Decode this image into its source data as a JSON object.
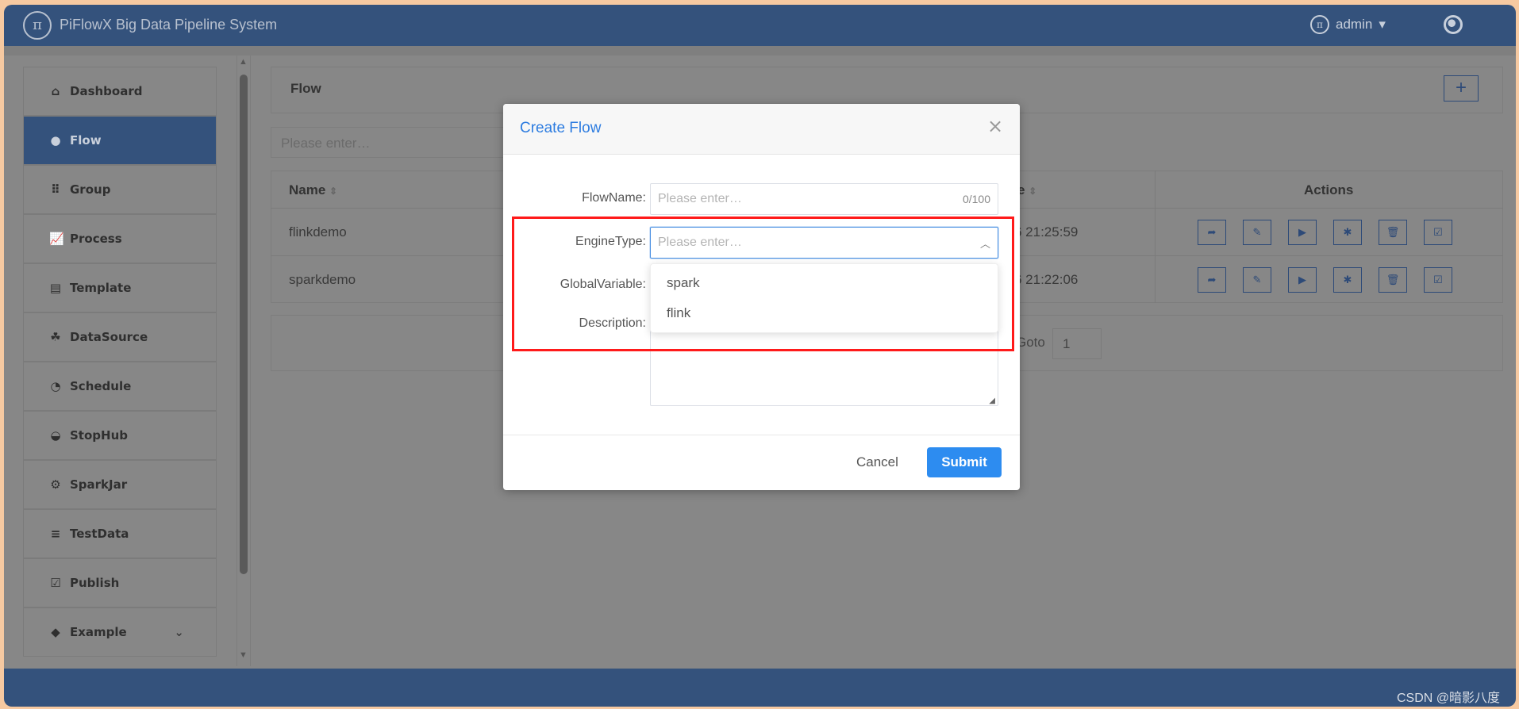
{
  "header": {
    "title": "PiFlowX Big Data Pipeline System",
    "logo_text": "π",
    "user": "admin"
  },
  "sidebar": {
    "items": [
      {
        "label": "Dashboard",
        "icon": "home-icon",
        "glyph": "⌂"
      },
      {
        "label": "Flow",
        "icon": "flow-icon",
        "glyph": "●",
        "active": true
      },
      {
        "label": "Group",
        "icon": "grid-icon",
        "glyph": "⠿"
      },
      {
        "label": "Process",
        "icon": "chart-icon",
        "glyph": "📈"
      },
      {
        "label": "Template",
        "icon": "document-icon",
        "glyph": "▤"
      },
      {
        "label": "DataSource",
        "icon": "datasource-icon",
        "glyph": "☘"
      },
      {
        "label": "Schedule",
        "icon": "clock-icon",
        "glyph": "◔"
      },
      {
        "label": "StopHub",
        "icon": "gauge-icon",
        "glyph": "◒"
      },
      {
        "label": "SparkJar",
        "icon": "gear-icon",
        "glyph": "⚙"
      },
      {
        "label": "TestData",
        "icon": "lines-icon",
        "glyph": "≡"
      },
      {
        "label": "Publish",
        "icon": "check-square-icon",
        "glyph": "☑"
      },
      {
        "label": "Example",
        "icon": "cube-icon",
        "glyph": "◆",
        "chevron": "⌄"
      }
    ]
  },
  "main": {
    "title": "Flow",
    "add_label": "+",
    "search_placeholder": "Please enter…",
    "table": {
      "headers": {
        "name": "Name",
        "time": "e",
        "actions": "Actions"
      },
      "rows": [
        {
          "name": "flinkdemo",
          "time": "6 21:25:59"
        },
        {
          "name": "sparkdemo",
          "time": "6 21:22:06"
        }
      ],
      "action_icons": [
        "share-icon",
        "edit-icon",
        "run-icon",
        "debug-icon",
        "delete-icon",
        "publish-icon"
      ],
      "action_glyphs": [
        "➦",
        "✎",
        "▶",
        "✱",
        "🗑",
        "☑"
      ]
    },
    "pagination": {
      "goto_label": "Goto",
      "page": "1"
    }
  },
  "dialog": {
    "title": "Create Flow",
    "close": "×",
    "fields": {
      "flowname": {
        "label": "FlowName:",
        "placeholder": "Please enter…",
        "counter": "0/100"
      },
      "enginetype": {
        "label": "EngineType:",
        "placeholder": "Please enter…",
        "options": [
          "spark",
          "flink"
        ]
      },
      "globalvariable": {
        "label": "GlobalVariable:"
      },
      "description": {
        "label": "Description:"
      }
    },
    "cancel": "Cancel",
    "submit": "Submit"
  },
  "footer": {
    "watermark": "CSDN @暗影八度"
  },
  "colors": {
    "header": "#34527c",
    "accent": "#2d8cf0",
    "highlight": "#ff1a1a"
  }
}
